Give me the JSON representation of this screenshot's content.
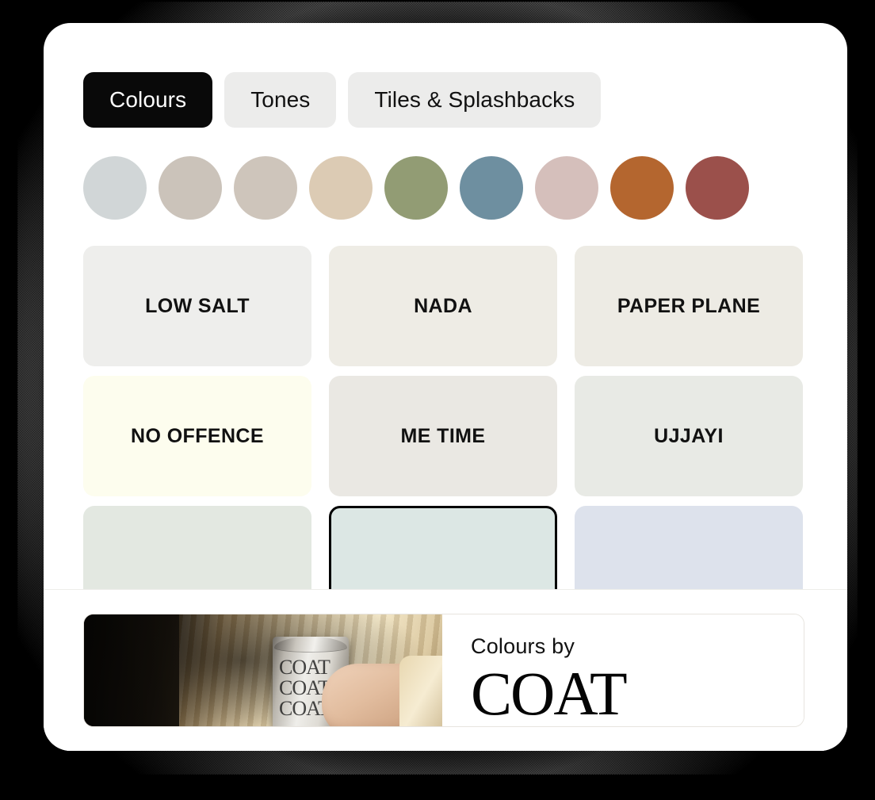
{
  "app": {
    "background_color": "#000000",
    "panel_color": "#ffffff"
  },
  "tabs": [
    {
      "label": "Colours",
      "active": true
    },
    {
      "label": "Tones",
      "active": false
    },
    {
      "label": "Tiles & Splashbacks",
      "active": false
    }
  ],
  "swatches": [
    {
      "name": "pale-blue-grey",
      "color": "#d1d6d7"
    },
    {
      "name": "warm-taupe",
      "color": "#cbc3ba"
    },
    {
      "name": "greige",
      "color": "#cec5bb"
    },
    {
      "name": "sand-beige",
      "color": "#dccbb4"
    },
    {
      "name": "sage-green",
      "color": "#929c74"
    },
    {
      "name": "steel-blue",
      "color": "#6e8fa0"
    },
    {
      "name": "dusty-pink",
      "color": "#d5bfbb"
    },
    {
      "name": "burnt-orange",
      "color": "#b4662f"
    },
    {
      "name": "brick-red",
      "color": "#9b504b"
    }
  ],
  "cards": [
    {
      "label": "LOW SALT",
      "color": "#eeeeec",
      "selected": false,
      "clipped": false
    },
    {
      "label": "NADA",
      "color": "#eeece5",
      "selected": false,
      "clipped": false
    },
    {
      "label": "PAPER PLANE",
      "color": "#edebe4",
      "selected": false,
      "clipped": false
    },
    {
      "label": "NO OFFENCE",
      "color": "#fdfdee",
      "selected": false,
      "clipped": false
    },
    {
      "label": "ME TIME",
      "color": "#eae8e3",
      "selected": false,
      "clipped": false
    },
    {
      "label": "UJJAYI",
      "color": "#e8eae5",
      "selected": false,
      "clipped": false
    },
    {
      "label": "",
      "color": "#e3e8e1",
      "selected": false,
      "clipped": true
    },
    {
      "label": "",
      "color": "#dce7e4",
      "selected": true,
      "clipped": true
    },
    {
      "label": "",
      "color": "#dde2ec",
      "selected": false,
      "clipped": true
    }
  ],
  "footer": {
    "tagline": "Colours by",
    "logo": "COAT",
    "photo_alt": "person-holding-paint-tin"
  }
}
